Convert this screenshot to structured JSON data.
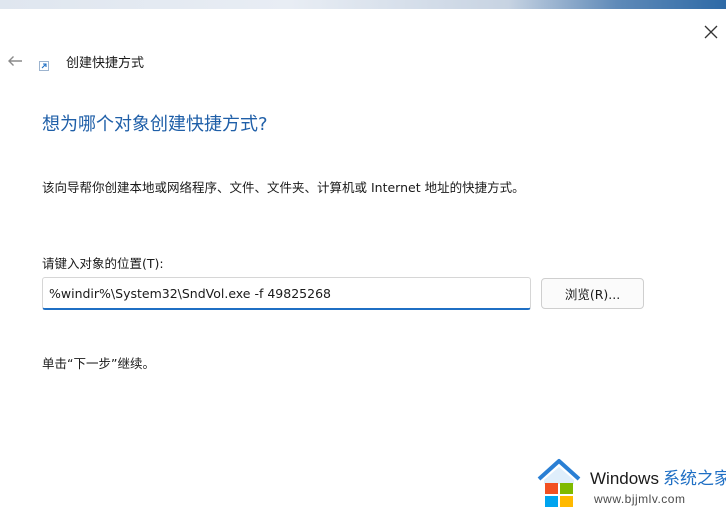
{
  "wizard": {
    "title": "创建快捷方式",
    "heading": "想为哪个对象创建快捷方式?",
    "description": "该向导帮你创建本地或网络程序、文件、文件夹、计算机或 Internet 地址的快捷方式。",
    "location_label": "请键入对象的位置(T):",
    "location_value": "%windir%\\System32\\SndVol.exe -f 49825268",
    "browse_label": "浏览(R)...",
    "hint": "单击“下一步”继续。"
  },
  "icons": {
    "back": "back-arrow-icon",
    "close": "close-icon",
    "shortcut": "shortcut-arrow-icon",
    "watermark_logo": "windows-house-logo"
  },
  "watermark": {
    "brand": "Windows",
    "brand_cn": "系统之家",
    "url": "www.bjjmlv.com"
  },
  "colors": {
    "heading": "#1f5fa8",
    "input_focus": "#1f6fc4",
    "text": "#1a1a1a"
  }
}
